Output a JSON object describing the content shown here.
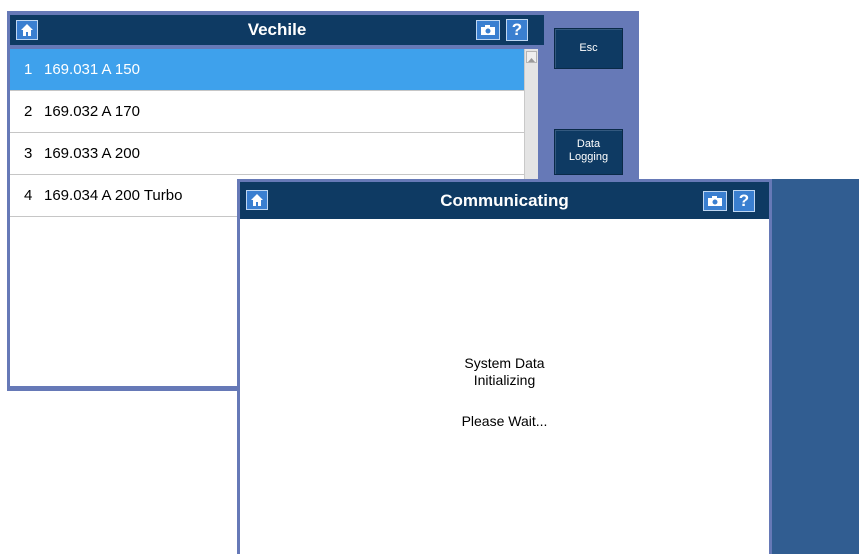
{
  "vehicle_window": {
    "title": "Vechile",
    "items": [
      {
        "num": "1",
        "label": "169.031 A 150"
      },
      {
        "num": "2",
        "label": "169.032 A 170"
      },
      {
        "num": "3",
        "label": "169.033 A 200"
      },
      {
        "num": "4",
        "label": "169.034 A 200 Turbo"
      }
    ],
    "selected_index": 0,
    "help_label": "?"
  },
  "side_buttons": {
    "esc": "Esc",
    "data_logging_line1": "Data",
    "data_logging_line2": "Logging"
  },
  "comm_window": {
    "title": "Communicating",
    "help_label": "?",
    "message_line1": "System Data",
    "message_line2": "Initializing",
    "message_line3": "Please Wait..."
  },
  "icons": {
    "home": "home-icon",
    "camera": "camera-icon",
    "help": "help-icon"
  },
  "colors": {
    "titlebar": "#0e3a63",
    "frame": "#6679b7",
    "selected_row": "#3ea1ec",
    "icon_button": "#3a7fd0"
  }
}
